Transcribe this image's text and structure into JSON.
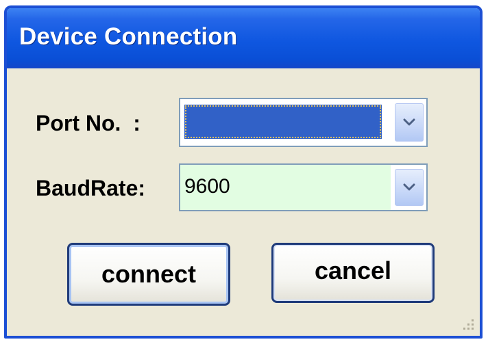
{
  "window": {
    "title": "Device Connection"
  },
  "form": {
    "port_label": "Port No.  :",
    "port_value": "",
    "baud_label": "BaudRate:",
    "baud_value": "9600"
  },
  "buttons": {
    "connect": "connect",
    "cancel": "cancel"
  },
  "colors": {
    "titlebar": "#0a4fd6",
    "window_bg": "#ece9d8",
    "selection": "#3161c7",
    "baud_field_bg": "#e2fde2"
  },
  "icons": {
    "dropdown": "chevron-down-icon",
    "resize": "resize-grip-icon"
  }
}
